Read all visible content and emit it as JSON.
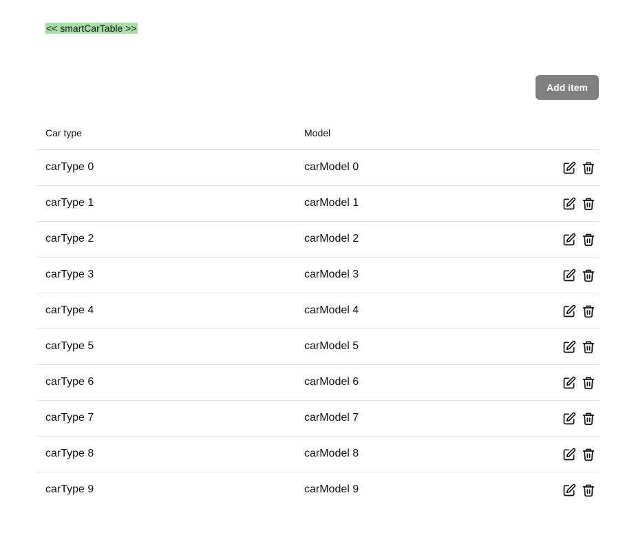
{
  "component_tag": "<< smartCarTable >>",
  "toolbar": {
    "add_label": "Add item"
  },
  "table": {
    "columns": [
      "Car type",
      "Model"
    ],
    "rows": [
      {
        "type": "carType 0",
        "model": "carModel 0"
      },
      {
        "type": "carType 1",
        "model": "carModel 1"
      },
      {
        "type": "carType 2",
        "model": "carModel 2"
      },
      {
        "type": "carType 3",
        "model": "carModel 3"
      },
      {
        "type": "carType 4",
        "model": "carModel 4"
      },
      {
        "type": "carType 5",
        "model": "carModel 5"
      },
      {
        "type": "carType 6",
        "model": "carModel 6"
      },
      {
        "type": "carType 7",
        "model": "carModel 7"
      },
      {
        "type": "carType 8",
        "model": "carModel 8"
      },
      {
        "type": "carType 9",
        "model": "carModel 9"
      }
    ],
    "row_actions": [
      "edit-icon",
      "trash-icon"
    ]
  },
  "colors": {
    "tag_highlight": "#a6dea6",
    "button_bg": "#808080",
    "button_text": "#ffffff",
    "divider": "#e3e3e3"
  }
}
